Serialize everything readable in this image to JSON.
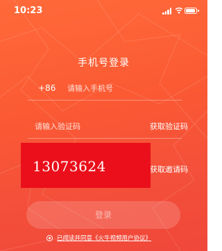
{
  "status_bar": {
    "time": "10:23",
    "icons": [
      "signal-icon",
      "wifi-icon",
      "battery-icon"
    ]
  },
  "login": {
    "title": "手机号登录",
    "country_code": "+86",
    "phone_placeholder": "请输入手机号",
    "code_placeholder": "请输入验证码",
    "get_code_label": "获取验证码",
    "get_invite_label": "获取邀请码",
    "overlay_number": "13073624",
    "login_label": "登录",
    "agreement_text": "已阅读并同意《火牛视频用户协议》"
  },
  "colors": {
    "background_start": "#ff6a3a",
    "background_end": "#f0473a",
    "overlay_red": "#ea0f1b",
    "text": "#ffffff"
  }
}
